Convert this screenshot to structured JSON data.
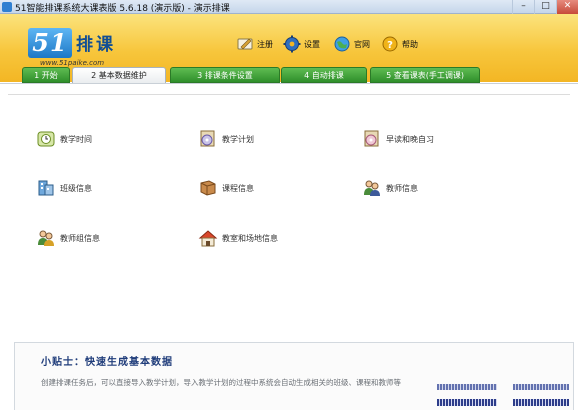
{
  "window": {
    "title": "51智能排课系统大课表版 5.6.18 (演示版) - 演示排课",
    "minimize": "–",
    "maximize": "□",
    "close": "✕"
  },
  "logo": {
    "number": "51",
    "name": "排课",
    "url": "www.51paike.com"
  },
  "toolbar": {
    "items": [
      {
        "label": "注册",
        "icon": "register-icon"
      },
      {
        "label": "设置",
        "icon": "settings-gear-icon"
      },
      {
        "label": "官网",
        "icon": "globe-icon"
      },
      {
        "label": "帮助",
        "icon": "help-icon"
      }
    ]
  },
  "tabs": [
    {
      "label": "1 开始"
    },
    {
      "label": "2 基本数据维护",
      "active": true
    },
    {
      "label": "3 排课条件设置"
    },
    {
      "label": "4 自动排课"
    },
    {
      "label": "5 查看课表(手工调课)"
    }
  ],
  "items": [
    {
      "label": "教学时间",
      "icon": "clock-icon"
    },
    {
      "label": "教学计划",
      "icon": "disc-plan-icon"
    },
    {
      "label": "早读和晚自习",
      "icon": "disc-study-icon"
    },
    {
      "label": "班级信息",
      "icon": "class-building-icon"
    },
    {
      "label": "课程信息",
      "icon": "book-icon"
    },
    {
      "label": "教师信息",
      "icon": "teachers-icon"
    },
    {
      "label": "教师组信息",
      "icon": "teacher-group-icon"
    },
    {
      "label": "教室和场地信息",
      "icon": "house-icon"
    }
  ],
  "tips": {
    "title": "小贴士：快速生成基本数据",
    "body": "创建排课任务后，可以直接导入教学计划，导入教学计划的过程中系统会自动生成相关的班级、课程和教师等"
  },
  "colors": {
    "header_top": "#fbe37d",
    "header_bottom": "#f3b624",
    "tab_green": "#3fa338",
    "logo_blue": "#1d78c6"
  }
}
